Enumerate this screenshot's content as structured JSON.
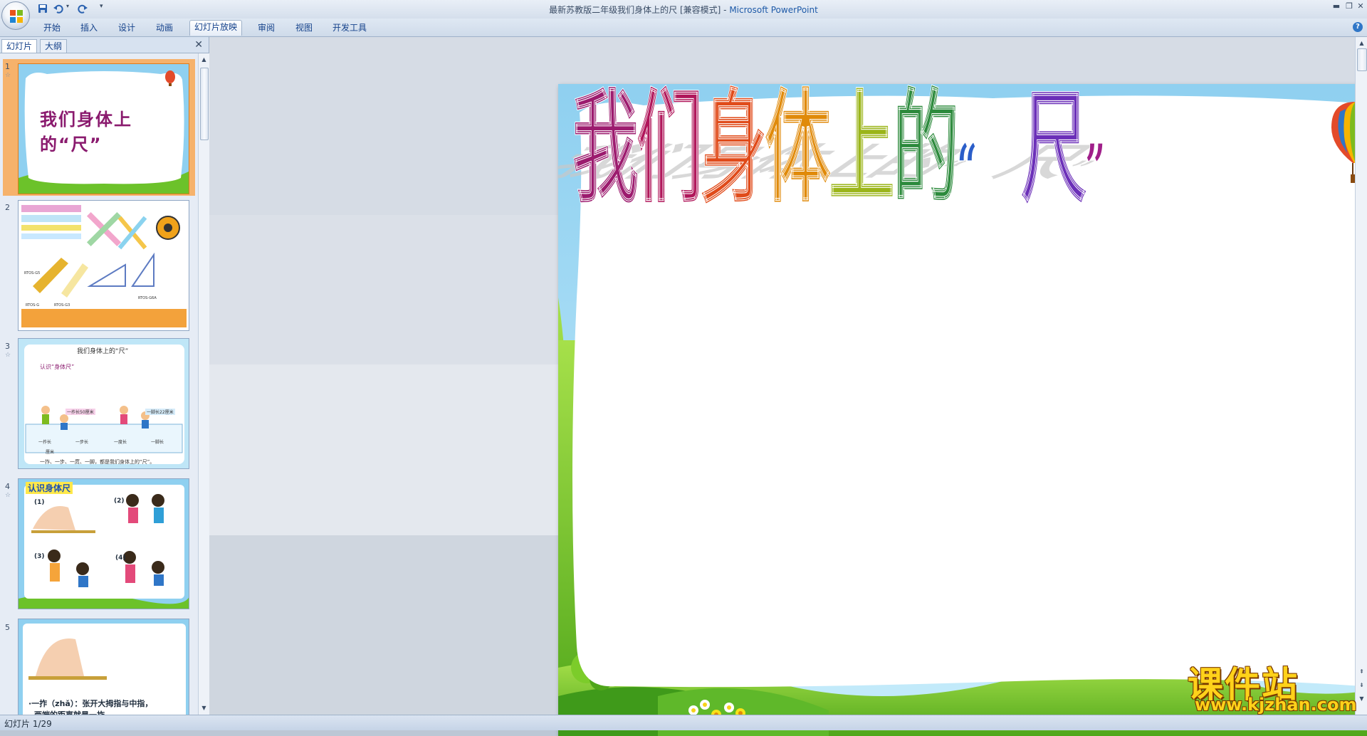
{
  "window": {
    "title": "最新苏教版二年级我们身体上的尺 [兼容模式]",
    "title_sep": " - ",
    "app_name": "Microsoft PowerPoint"
  },
  "ribbon": {
    "tabs": [
      "开始",
      "插入",
      "设计",
      "动画",
      "幻灯片放映",
      "审阅",
      "视图",
      "开发工具"
    ],
    "active_tab_index": 4
  },
  "left_pane": {
    "tabs": [
      "幻灯片",
      "大纲"
    ],
    "active_tab_index": 0,
    "slides": [
      {
        "num": "1",
        "title": "我们身体上的“尺”"
      },
      {
        "num": "2",
        "labels": [
          "RTOS-G5",
          "RTOS-G6A",
          "RTOS-G3",
          "RTOS-G"
        ]
      },
      {
        "num": "3",
        "header": "我们身体上的“尺”",
        "section": "认识“身体尺”",
        "tag1": "一拃长50厘米",
        "tag2": "一脚长22厘米",
        "table_cols": [
          "一拃长",
          "一步长",
          "一度长",
          "一脚长"
        ],
        "table_unit": "厘米",
        "footer": "一拃、一步、一庹、一脚，都是我们身体上的“尺”。"
      },
      {
        "num": "4",
        "heading": "认识身体尺",
        "items": [
          "(1)",
          "(2)",
          "(3)",
          "(4)"
        ]
      },
      {
        "num": "5",
        "text": "·一拃（zhǎ）：张开大拇指与中指，",
        "text2": "两端的距离就是一拃。",
        "highlight": "中指"
      }
    ],
    "selected_slide": 1
  },
  "slide": {
    "title": "我们身体上的“尺”",
    "title_chars": [
      "我",
      "们",
      "身",
      "体",
      "上",
      "的",
      "“",
      "尺",
      "”"
    ],
    "title_colors": [
      "#9c1b6e",
      "#b0165a",
      "#e04b1a",
      "#e08a0a",
      "#9bb51a",
      "#2c8a3c",
      "#2b5ec9",
      "#6b2fb8",
      "#a01f8a"
    ],
    "sky_color": "#8fd0f0",
    "grass_color": "#6cc22a"
  },
  "status": {
    "slide_indicator": "幻灯片 1/29"
  },
  "watermark": {
    "name": "课件站",
    "url": "www.kjzhan.com"
  }
}
